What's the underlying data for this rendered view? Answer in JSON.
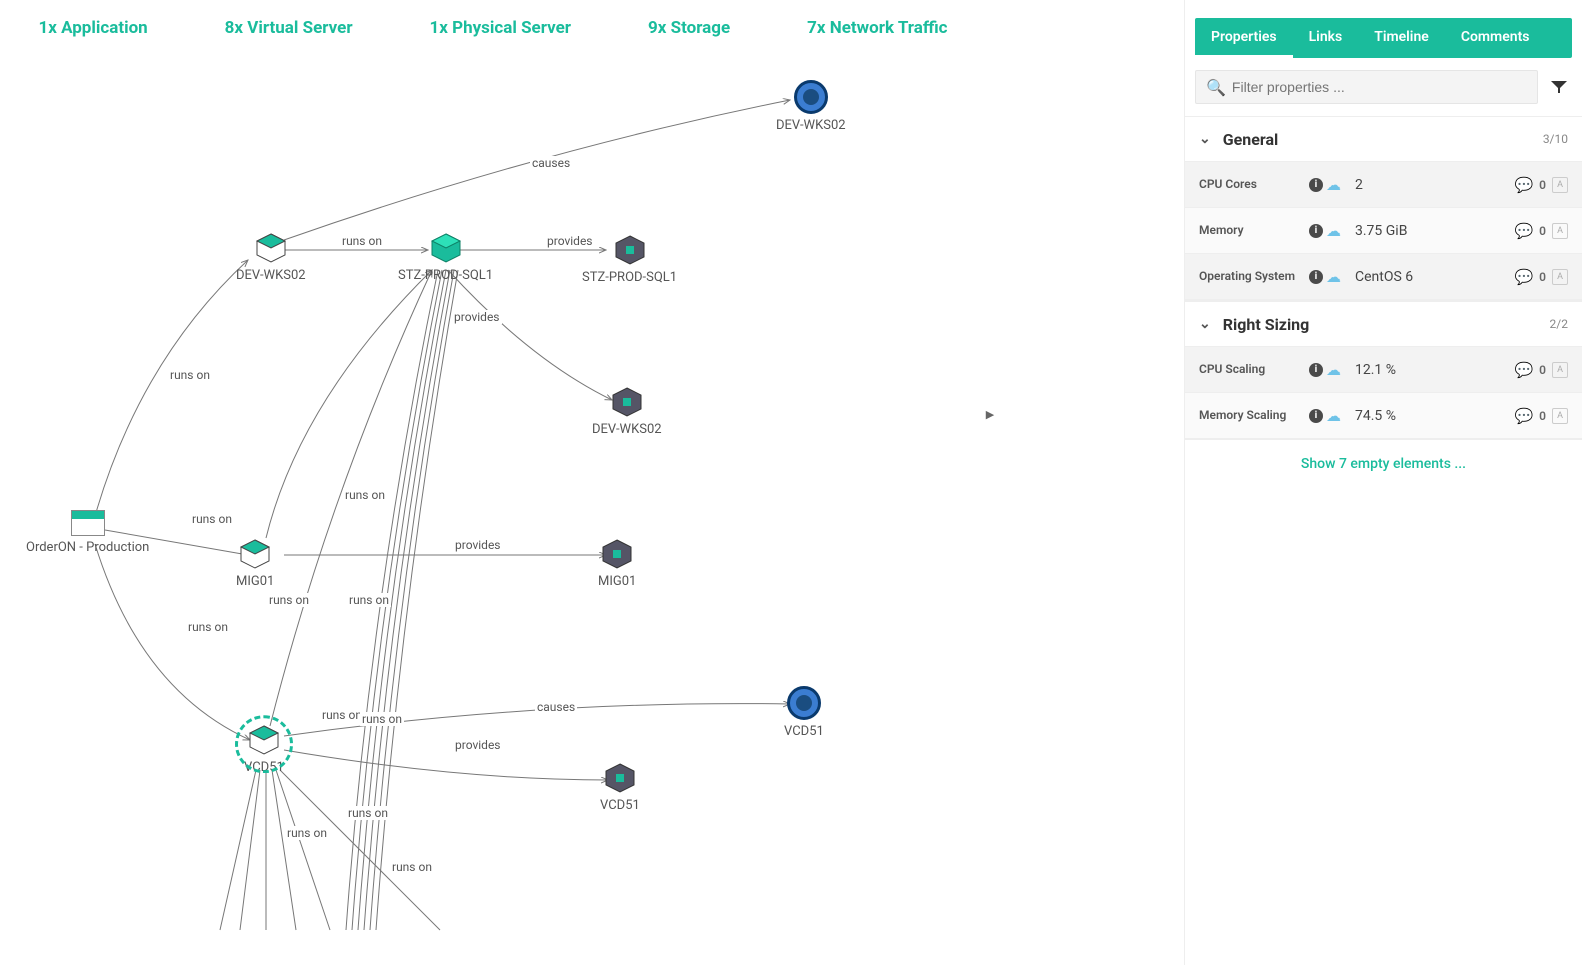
{
  "summary": {
    "application": "1x Application",
    "virtual_server": "8x Virtual Server",
    "physical_server": "1x Physical Server",
    "storage": "9x Storage",
    "network_traffic": "7x Network Traffic"
  },
  "nodes": {
    "orderon": "OrderON - Production",
    "dev_wks02_vs": "DEV-WKS02",
    "stz_ps": "STZ-PROD-SQL1",
    "mig01_vs": "MIG01",
    "vcd51_vs": "VCD51",
    "dev_wks02_nt": "DEV-WKS02",
    "stz_st": "STZ-PROD-SQL1",
    "dev_wks02_st": "DEV-WKS02",
    "mig01_st": "MIG01",
    "vcd51_nt": "VCD51",
    "vcd51_st": "VCD51"
  },
  "edges": {
    "runs_on": "runs on",
    "causes": "causes",
    "provides": "provides"
  },
  "panel": {
    "tabs": {
      "properties": "Properties",
      "links": "Links",
      "timeline": "Timeline",
      "comments": "Comments"
    },
    "filter_placeholder": "Filter properties ...",
    "groups": {
      "general": {
        "title": "General",
        "count": "3/10"
      },
      "right_sizing": {
        "title": "Right Sizing",
        "count": "2/2"
      }
    },
    "props": {
      "cpu_cores": {
        "name": "CPU Cores",
        "value": "2",
        "comments": "0",
        "badge": "A"
      },
      "memory": {
        "name": "Memory",
        "value": "3.75 GiB",
        "comments": "0",
        "badge": "A"
      },
      "os": {
        "name": "Operating System",
        "value": "CentOS 6",
        "comments": "0",
        "badge": "A"
      },
      "cpu_scaling": {
        "name": "CPU Scaling",
        "value": "12.1 %",
        "comments": "0",
        "badge": "A"
      },
      "mem_scaling": {
        "name": "Memory Scaling",
        "value": "74.5 %",
        "comments": "0",
        "badge": "A"
      }
    },
    "show_empty": "Show 7 empty elements ..."
  }
}
